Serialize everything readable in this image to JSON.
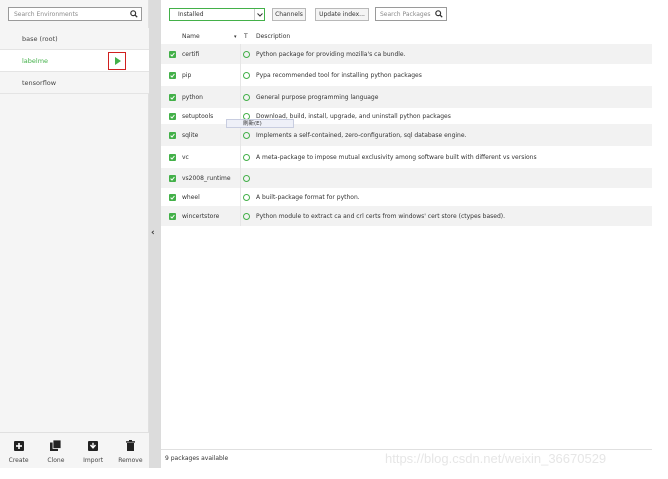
{
  "left": {
    "search_placeholder": "Search Environments",
    "environments": [
      {
        "label": "base (root)",
        "active": false
      },
      {
        "label": "labelme",
        "active": true
      },
      {
        "label": "tensorflow",
        "active": false
      }
    ],
    "actions": [
      {
        "label": "Create",
        "icon": "plus-square-icon"
      },
      {
        "label": "Clone",
        "icon": "clone-icon"
      },
      {
        "label": "Import",
        "icon": "import-icon"
      },
      {
        "label": "Remove",
        "icon": "trash-icon"
      }
    ],
    "collapse_glyph": "‹"
  },
  "toolbar": {
    "filter_value": "Installed",
    "channels_label": "Channels",
    "update_label": "Update index...",
    "search_placeholder": "Search Packages"
  },
  "table": {
    "col_name": "Name",
    "col_sort": "▾",
    "col_t": "T",
    "col_desc": "Description",
    "rows": [
      {
        "name": "certifi",
        "desc": "Python package for providing mozilla's ca bundle."
      },
      {
        "name": "pip",
        "desc": "Pypa recommended tool for installing python packages"
      },
      {
        "name": "python",
        "desc": "General purpose programming language"
      },
      {
        "name": "setuptools",
        "desc": "Download, build, install, upgrade, and uninstall python packages"
      },
      {
        "name": "sqlite",
        "desc": "Implements a self-contained, zero-configuration, sql database engine."
      },
      {
        "name": "vc",
        "desc": "A meta-package to impose mutual exclusivity among software built with different vs versions"
      },
      {
        "name": "vs2008_runtime",
        "desc": ""
      },
      {
        "name": "wheel",
        "desc": "A built-package format for python."
      },
      {
        "name": "wincertstore",
        "desc": "Python module to extract ca and crl certs from windows' cert store (ctypes based)."
      }
    ]
  },
  "tooltip": "刷新(E)",
  "footer": {
    "status": "9 packages available"
  },
  "watermark": "https://blog.csdn.net/weixin_36670529",
  "colors": {
    "accent": "#43b049",
    "highlight_box": "#d0201f"
  }
}
